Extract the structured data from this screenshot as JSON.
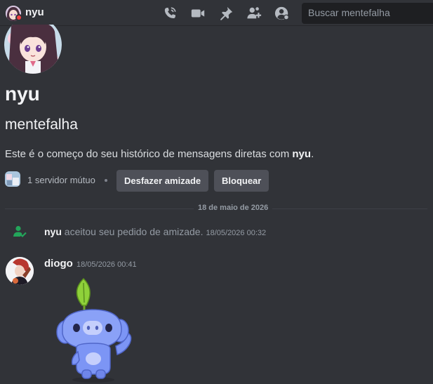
{
  "header": {
    "title": "nyu",
    "search_placeholder": "Buscar mentefalha",
    "icons": [
      "phone-call-icon",
      "video-call-icon",
      "pin-icon",
      "add-friend-icon",
      "profile-icon"
    ]
  },
  "profile": {
    "display_name": "nyu",
    "username": "mentefalha",
    "intro_prefix": "Este é o começo do seu histórico de mensagens diretas com ",
    "intro_name": "nyu",
    "intro_suffix": ".",
    "mutual_servers": "1 servidor mútuo",
    "unfriend_label": "Desfazer amizade",
    "block_label": "Bloquear"
  },
  "messages": {
    "date_divider": "18 de maio de 2026",
    "system": {
      "name": "nyu",
      "text": " aceitou seu pedido de amizade.",
      "time": "18/05/2026 00:32"
    },
    "message": {
      "author": "diogo",
      "time": "18/05/2026 00:41",
      "sticker": "wumpus-sprout-sticker"
    }
  },
  "colors": {
    "background": "#313338",
    "button": "#4e5058",
    "status_dnd": "#f23f43",
    "system_green": "#23a55a",
    "wumpus_blue": "#7c95f5"
  }
}
